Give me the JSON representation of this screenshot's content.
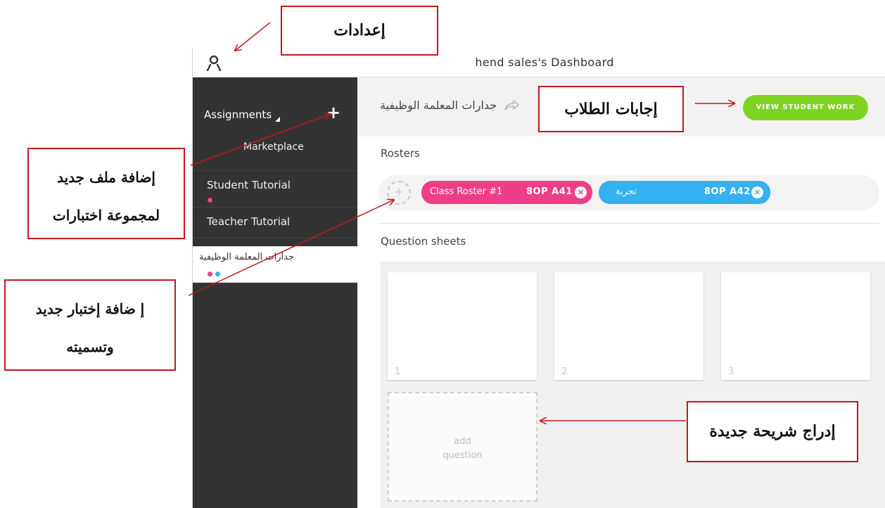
{
  "app": {
    "dashboard_title": "hend  sales's Dashboard",
    "icons": {
      "user": "user-icon",
      "add_assignment": "plus-icon",
      "share": "share-arrow-icon",
      "remove": "close-circle-icon",
      "add": "plus-circle-icon"
    }
  },
  "sidebar": {
    "assignments_label": "Assignments",
    "add_symbol": "+",
    "marketplace_label": "Marketplace",
    "items": [
      {
        "label": "Student Tutorial",
        "dot_colors": [
          "#e8458b"
        ]
      },
      {
        "label": "Teacher Tutorial",
        "dot_colors": []
      },
      {
        "label": "جدارات المعلمة الوظيفية",
        "dot_colors": [
          "#e8458b",
          "#2fb2f0"
        ],
        "active": true
      }
    ]
  },
  "main": {
    "assignment_name": "جدارات المعلمة الوظيفية",
    "view_button_label": "VIEW STUDENT WORK",
    "rosters_label": "Rosters",
    "add_roster_symbol": "+",
    "rosters": [
      {
        "name": "Class Roster #1",
        "code": "8OP  A41",
        "color": "#ee3e88"
      },
      {
        "name": "تجربة",
        "code": "8OP  A42",
        "color": "#33b1f1"
      }
    ],
    "remove_symbol": "×",
    "question_sheets_label": "Question sheets",
    "question_cards": [
      "1",
      "2",
      "3"
    ],
    "add_question_label_line1": "add",
    "add_question_label_line2": "question"
  },
  "callouts": {
    "settings": "إعدادات",
    "student_answers": "إجابات الطلاب",
    "add_file_line1": "إضافة ملف جديد",
    "add_file_line2": "لمجموعة اختبارات",
    "add_test_line1": "إ ضافة إختبار جديد",
    "add_test_line2": "وتسميته",
    "insert_slide": "إدراج شريحة جديدة"
  },
  "colors": {
    "sidebar_bg": "#333333",
    "accent_green": "#7ed321",
    "callout_border": "#c0181f"
  }
}
